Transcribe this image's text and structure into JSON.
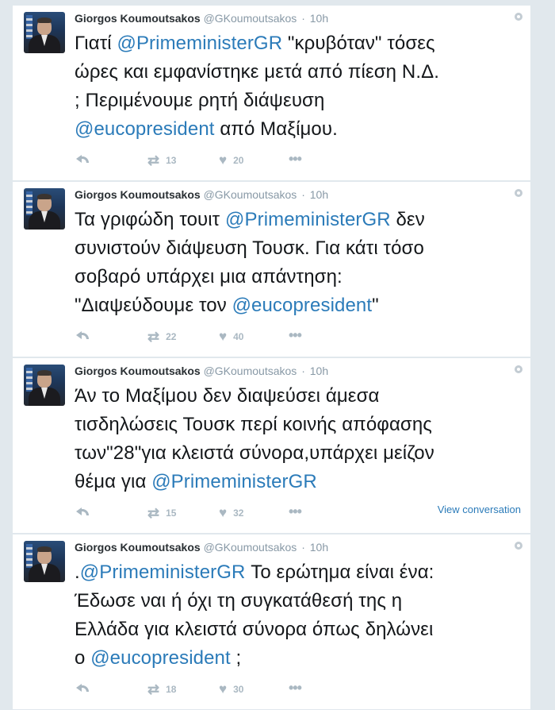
{
  "tweets": [
    {
      "name": "Giorgos Koumoutsakos",
      "handle": "@GKoumoutsakos",
      "time": "10h",
      "lines": [
        [
          {
            "t": "Γιατί "
          },
          {
            "t": "@PrimeministerGR",
            "m": true
          },
          {
            "t": " \"κρυβόταν\" τόσες"
          }
        ],
        [
          {
            "t": "ώρες και εμφανίστηκε μετά από πίεση Ν.Δ."
          }
        ],
        [
          {
            "t": "; Περιμένουμε ρητή διάψευση"
          }
        ],
        [
          {
            "t": "@eucopresident",
            "m": true
          },
          {
            "t": " από Μαξίμου."
          }
        ]
      ],
      "retweets": "13",
      "likes": "20"
    },
    {
      "name": "Giorgos Koumoutsakos",
      "handle": "@GKoumoutsakos",
      "time": "10h",
      "lines": [
        [
          {
            "t": "Τα γριφώδη τουιτ "
          },
          {
            "t": "@PrimeministerGR",
            "m": true
          },
          {
            "t": " δεν"
          }
        ],
        [
          {
            "t": "συνιστούν διάψευση Τουσκ. Για κάτι τόσο"
          }
        ],
        [
          {
            "t": "σοβαρό υπάρχει μια απάντηση:"
          }
        ],
        [
          {
            "t": "\"Διαψεύδουμε τον "
          },
          {
            "t": "@eucopresident",
            "m": true
          },
          {
            "t": "\""
          }
        ]
      ],
      "retweets": "22",
      "likes": "40"
    },
    {
      "name": "Giorgos Koumoutsakos",
      "handle": "@GKoumoutsakos",
      "time": "10h",
      "lines": [
        [
          {
            "t": "Άν το Μαξίμου δεν διαψεύσει άμεσα"
          }
        ],
        [
          {
            "t": "τισδηλώσεις Τουσκ περί κοινής απόφασης"
          }
        ],
        [
          {
            "t": "των\"28\"για κλειστά σύνορα,υπάρχει μείζον"
          }
        ],
        [
          {
            "t": "θέμα για "
          },
          {
            "t": "@PrimeministerGR",
            "m": true
          }
        ]
      ],
      "view_conversation": "View conversation",
      "retweets": "15",
      "likes": "32"
    },
    {
      "name": "Giorgos Koumoutsakos",
      "handle": "@GKoumoutsakos",
      "time": "10h",
      "lines": [
        [
          {
            "t": "."
          },
          {
            "t": "@PrimeministerGR",
            "m": true
          },
          {
            "t": " Το ερώτημα είναι ένα:"
          }
        ],
        [
          {
            "t": "Έδωσε ναι ή όχι τη συγκατάθεσή της η"
          }
        ],
        [
          {
            "t": "Ελλάδα για κλειστά σύνορα όπως δηλώνει"
          }
        ],
        [
          {
            "t": "ο "
          },
          {
            "t": "@eucopresident",
            "m": true
          },
          {
            "t": " ;"
          }
        ]
      ],
      "retweets": "18",
      "likes": "30"
    }
  ],
  "icons": {
    "reply": "reply-icon",
    "retweet": "retweet-icon",
    "like": "heart-icon",
    "more": "more-icon",
    "settings": "gear-icon"
  },
  "colors": {
    "link": "#2b7bb9",
    "background": "#e1e8ed",
    "muted": "#8899a6",
    "icon": "#aab8c2"
  }
}
